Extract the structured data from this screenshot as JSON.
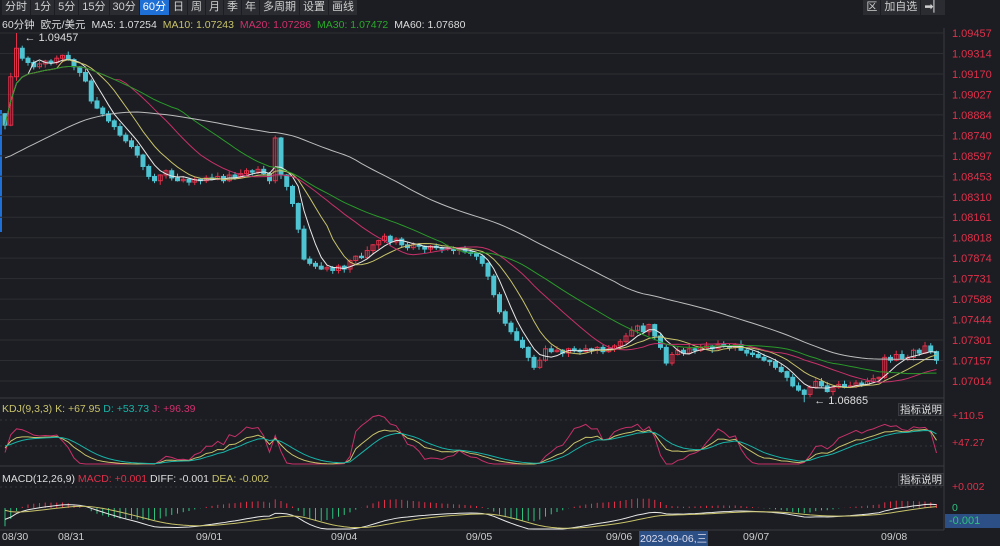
{
  "toolbar": {
    "periods": [
      "分时",
      "1分",
      "5分",
      "15分",
      "30分",
      "60分",
      "日",
      "周",
      "月",
      "季",
      "年",
      "多周期",
      "设置",
      "画线"
    ],
    "active": "60分",
    "right": [
      {
        "label": "区",
        "icon": "region-icon"
      },
      {
        "label": "加自选",
        "icon": ""
      },
      {
        "label": "",
        "icon": "exit-arrow-icon"
      }
    ]
  },
  "info": {
    "period": "60分钟",
    "symbol": "欧元/美元",
    "ma5": "MA5: 1.07254",
    "ma10": "MA10: 1.07243",
    "ma20": "MA20: 1.07286",
    "ma30": "MA30: 1.07472",
    "ma60": "MA60: 1.07680"
  },
  "colors": {
    "up": "#e0304a",
    "down": "#4ec3d1",
    "ma5": "#e8e8e8",
    "ma10": "#c8c26a",
    "ma20": "#c8306a",
    "ma30": "#2a9a2a",
    "ma60": "#bdbdbd",
    "k": "#c8c26a",
    "d": "#19b3a8",
    "j": "#c8306a"
  },
  "kdj": {
    "title": "KDJ(9,3,3)",
    "k": "K: +67.95",
    "d": "D: +53.73",
    "j": "J: +96.39",
    "axis": [
      "+110.5",
      "+47.27"
    ],
    "explain": "指标说明"
  },
  "macd": {
    "title": "MACD(12,26,9)",
    "macd": "MACD: +0.001",
    "diff": "DIFF: -0.001",
    "dea": "DEA: -0.002",
    "axis": [
      "+0.002",
      "0"
    ],
    "current": "-0.001",
    "explain": "指标说明"
  },
  "dates": [
    "08/30",
    "08/31",
    "09/01",
    "09/04",
    "09/05",
    "09/06",
    "2023-09-06,三",
    "09/07",
    "09/08"
  ],
  "chart_data": {
    "type": "candlestick",
    "price_axis": [
      "1.09457",
      "1.09314",
      "1.09170",
      "1.09027",
      "1.08884",
      "1.08740",
      "1.08597",
      "1.08453",
      "1.08310",
      "1.08161",
      "1.08018",
      "1.07874",
      "1.07731",
      "1.07588",
      "1.07444",
      "1.07301",
      "1.07157",
      "1.07014"
    ],
    "ylim": [
      1.07014,
      1.09457
    ],
    "high_label": "1.09457",
    "low_label": "1.06865",
    "close": [
      1.0881,
      1.0915,
      1.0935,
      1.0928,
      1.0925,
      1.0922,
      1.0924,
      1.0926,
      1.0925,
      1.0928,
      1.093,
      1.0927,
      1.0922,
      1.0918,
      1.0912,
      1.0898,
      1.0893,
      1.0889,
      1.0884,
      1.088,
      1.0874,
      1.087,
      1.0866,
      1.086,
      1.0852,
      1.0845,
      1.0842,
      1.0846,
      1.0849,
      1.0844,
      1.0842,
      1.0843,
      1.0841,
      1.0843,
      1.0842,
      1.0844,
      1.0843,
      1.0845,
      1.0842,
      1.0846,
      1.0844,
      1.0847,
      1.0849,
      1.0848,
      1.085,
      1.0847,
      1.0842,
      1.0872,
      1.0846,
      1.0838,
      1.0826,
      1.0808,
      1.0787,
      1.0784,
      1.0782,
      1.078,
      1.0781,
      1.0779,
      1.0782,
      1.078,
      1.0786,
      1.0789,
      1.0788,
      1.0793,
      1.0797,
      1.08,
      1.0803,
      1.0799,
      1.0801,
      1.0797,
      1.0795,
      1.0797,
      1.0796,
      1.0794,
      1.0796,
      1.0795,
      1.0794,
      1.0795,
      1.0793,
      1.0794,
      1.0792,
      1.0791,
      1.0789,
      1.0784,
      1.0775,
      1.0762,
      1.075,
      1.0742,
      1.0736,
      1.073,
      1.0725,
      1.0718,
      1.0711,
      1.0716,
      1.0724,
      1.0722,
      1.0723,
      1.0721,
      1.0724,
      1.0723,
      1.0722,
      1.0724,
      1.0723,
      1.0725,
      1.0722,
      1.0724,
      1.0726,
      1.0729,
      1.0733,
      1.0737,
      1.074,
      1.0736,
      1.0741,
      1.0733,
      1.0725,
      1.0714,
      1.072,
      1.0723,
      1.0721,
      1.0724,
      1.0723,
      1.0725,
      1.0726,
      1.0724,
      1.0727,
      1.0726,
      1.0725,
      1.0727,
      1.0723,
      1.0721,
      1.072,
      1.0718,
      1.0716,
      1.0715,
      1.0711,
      1.0708,
      1.0704,
      1.0698,
      1.0695,
      1.0692,
      1.0697,
      1.0701,
      1.0698,
      1.0694,
      1.0697,
      1.0699,
      1.0697,
      1.0698,
      1.07,
      1.0699,
      1.0701,
      1.0703,
      1.0704,
      1.0718,
      1.0716,
      1.072,
      1.0717,
      1.0718,
      1.0723,
      1.0721,
      1.0726,
      1.0722,
      1.0716
    ]
  }
}
